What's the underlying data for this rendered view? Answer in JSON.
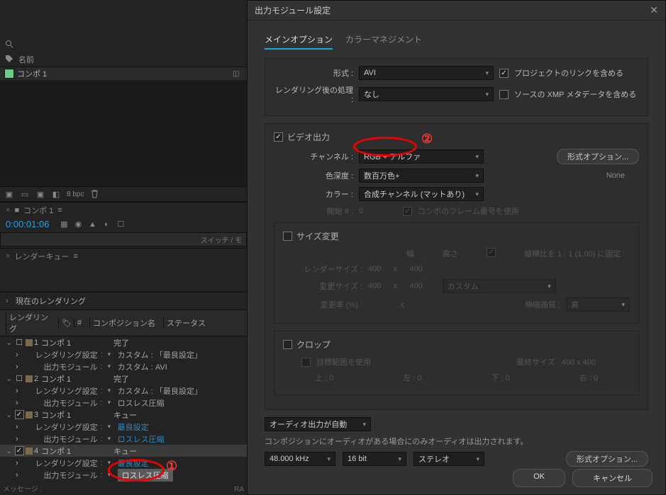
{
  "project": {
    "name_header": "名前",
    "item": "コンポ 1"
  },
  "toolbar": {
    "bpc": "8 bpc"
  },
  "timeline_tab": "コンポ 1",
  "timecode": "0:00:01:06",
  "strip_text": "スイッチ / モ",
  "render_tab": "レンダーキュー",
  "current_render": "現在のレンダリング",
  "queue_head": {
    "render": "レンダリング",
    "num": "#",
    "comp": "コンポジション名",
    "status": "ステータス"
  },
  "labels": {
    "render_settings": "レンダリング設定",
    "output_module": "出力モジュール"
  },
  "vals": {
    "custom_best": "カスタム : 「最良設定」",
    "custom_avi": "カスタム : AVI",
    "best": "最良設定",
    "lossless": "ロスレス圧縮"
  },
  "status": {
    "done": "完了",
    "queue": "キュー"
  },
  "items": [
    {
      "idx": "1",
      "comp": "コンポ 1"
    },
    {
      "idx": "2",
      "comp": "コンポ 1"
    },
    {
      "idx": "3",
      "comp": "コンポ 1"
    },
    {
      "idx": "4",
      "comp": "コンポ 1"
    }
  ],
  "msg": "メッセージ :",
  "ram": "RA",
  "dialog": {
    "title": "出力モジュール設定",
    "tab_main": "メインオプション",
    "tab_color": "カラーマネジメント",
    "format_label": "形式 :",
    "format_value": "AVI",
    "include_link": "プロジェクトのリンクを含める",
    "postrender_label": "レンダリング後の処理 :",
    "postrender_value": "なし",
    "include_xmp": "ソースの XMP メタデータを含める",
    "video_out": "ビデオ出力",
    "channel_label": "チャンネル :",
    "channel_value": "RGB + アルファ",
    "format_opt_btn": "形式オプション...",
    "depth_label": "色深度 :",
    "depth_value": "数百万色+",
    "none": "None",
    "color_label": "カラー :",
    "color_value": "合成チャンネル (マットあり)",
    "start_label": "開始 # :",
    "start_value": "0",
    "use_frame": "コンポのフレーム番号を使用",
    "resize": "サイズ変更",
    "width": "幅",
    "height": "高さ",
    "lock_aspect": "縦横比を 1 : 1 (1.00) に固定",
    "render_size": "レンダーサイズ :",
    "resize_size": "変更サイズ :",
    "resize_pct": "変更率 (%) :",
    "size_400": "400",
    "x": "x",
    "custom": "カスタム",
    "shrink_q": "伸縮画質 :",
    "high": "高",
    "crop": "クロップ",
    "use_target": "目標範囲を使用",
    "final_size": "最終サイズ : 400 x 400",
    "top": "上 :",
    "left": "左 :",
    "bottom": "下 :",
    "right": "右 :",
    "zero": "0",
    "audio_auto": "オーディオ出力が自動",
    "audio_hint": "コンポジションにオーディオがある場合にのみオーディオは出力されます。",
    "khz": "48.000 kHz",
    "bit": "16 bit",
    "stereo": "ステレオ",
    "ok": "OK",
    "cancel": "キャンセル"
  },
  "anno": {
    "one": "①",
    "two": "②"
  }
}
